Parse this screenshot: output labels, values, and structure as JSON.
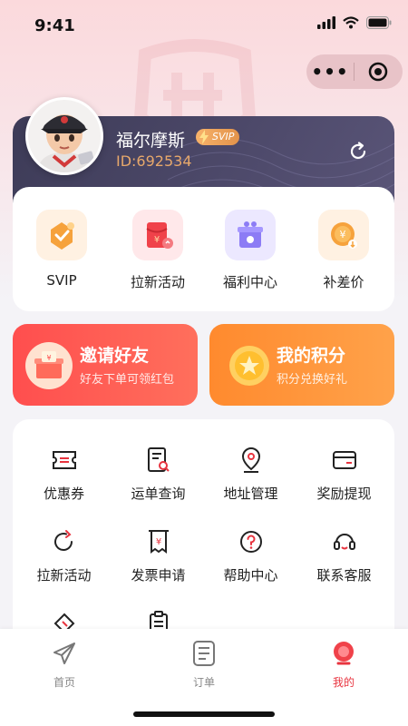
{
  "status_bar": {
    "time": "9:41"
  },
  "profile": {
    "name": "福尔摩斯",
    "badge": "SVIP",
    "id_text": "ID:692534"
  },
  "quick_actions": [
    {
      "label": "SVIP",
      "icon": "svip-icon"
    },
    {
      "label": "拉新活动",
      "icon": "red-envelope-icon"
    },
    {
      "label": "福利中心",
      "icon": "gift-icon"
    },
    {
      "label": "补差价",
      "icon": "coin-icon"
    }
  ],
  "banners": {
    "invite": {
      "title": "邀请好友",
      "subtitle": "好友下单可领红包"
    },
    "points": {
      "title": "我的积分",
      "subtitle": "积分兑换好礼"
    }
  },
  "services": [
    {
      "label": "优惠券",
      "icon": "coupon-icon"
    },
    {
      "label": "运单查询",
      "icon": "waybill-search-icon"
    },
    {
      "label": "地址管理",
      "icon": "location-icon"
    },
    {
      "label": "奖励提现",
      "icon": "wallet-icon"
    },
    {
      "label": "拉新活动",
      "icon": "refresh-arrow-icon"
    },
    {
      "label": "发票申请",
      "icon": "invoice-icon"
    },
    {
      "label": "帮助中心",
      "icon": "help-icon"
    },
    {
      "label": "联系客服",
      "icon": "headset-icon"
    }
  ],
  "tabbar": [
    {
      "label": "首页",
      "icon": "paper-plane-icon"
    },
    {
      "label": "订单",
      "icon": "order-list-icon"
    },
    {
      "label": "我的",
      "icon": "me-icon",
      "active": true
    }
  ],
  "colors": {
    "accent": "#e8343f",
    "profile_bg": "#3d3b57",
    "invite_banner": "#ff4e4e",
    "points_banner": "#ff8a2e"
  }
}
